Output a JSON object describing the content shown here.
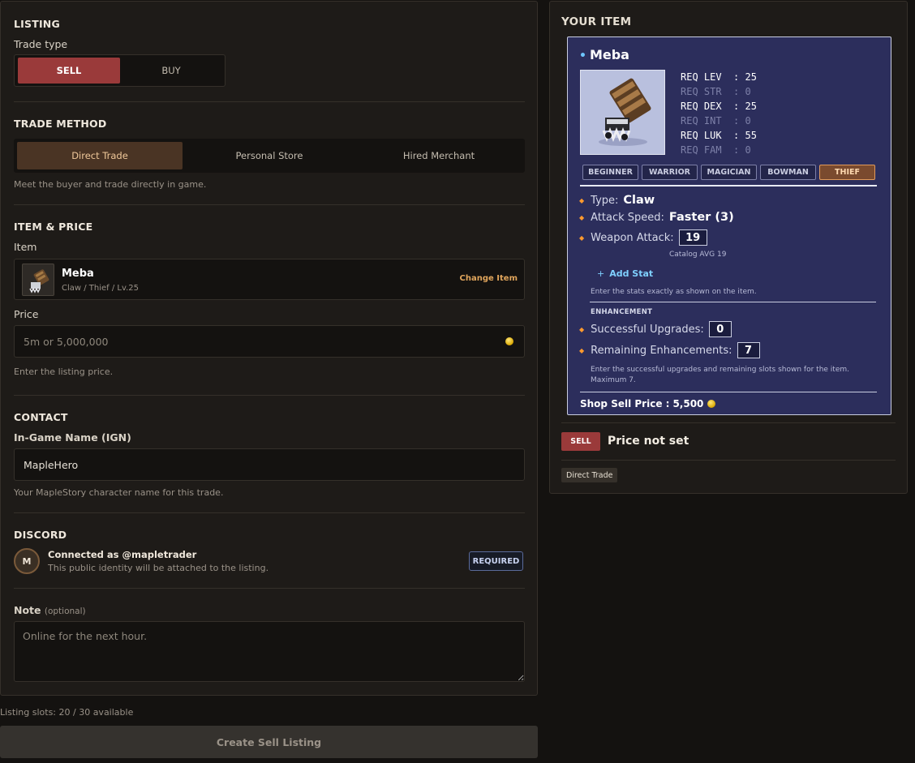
{
  "listing": {
    "section_title": "LISTING",
    "trade_type_label": "Trade type",
    "trade_types": {
      "sell": "SELL",
      "buy": "BUY"
    },
    "selected_trade_type": "SELL"
  },
  "trade_method": {
    "section_title": "TRADE METHOD",
    "options": [
      "Direct Trade",
      "Personal Store",
      "Hired Merchant"
    ],
    "selected": "Direct Trade",
    "hint": "Meet the buyer and trade directly in game."
  },
  "item_price": {
    "section_title": "ITEM & PRICE",
    "item_label": "Item",
    "item": {
      "name": "Meba",
      "subtitle": "Claw / Thief / Lv.25",
      "change_label": "Change Item"
    },
    "price_label": "Price",
    "price_value": "",
    "price_placeholder": "5m or 5,000,000",
    "price_hint": "Enter the listing price."
  },
  "contact": {
    "section_title": "CONTACT",
    "ign_label": "In-Game Name (IGN)",
    "ign_value": "MapleHero",
    "ign_hint": "Your MapleStory character name for this trade."
  },
  "discord": {
    "section_title": "DISCORD",
    "avatar_letter": "M",
    "connected_text": "Connected as @mapletrader",
    "identity_hint": "This public identity will be attached to the listing.",
    "required_badge": "REQUIRED"
  },
  "note": {
    "label": "Note",
    "optional": "(optional)",
    "value": "",
    "placeholder": "Online for the next hour."
  },
  "footer": {
    "slots_text": "Listing slots: 20 / 30 available",
    "create_button": "Create Sell Listing"
  },
  "preview": {
    "title": "YOUR ITEM",
    "item_name": "Meba",
    "requirements": [
      {
        "text": "REQ LEV  : 25",
        "met": true
      },
      {
        "text": "REQ STR  : 0",
        "met": false
      },
      {
        "text": "REQ DEX  : 25",
        "met": true
      },
      {
        "text": "REQ INT  : 0",
        "met": false
      },
      {
        "text": "REQ LUK  : 55",
        "met": true
      },
      {
        "text": "REQ FAM  : 0",
        "met": false
      }
    ],
    "jobs": [
      "BEGINNER",
      "WARRIOR",
      "MAGICIAN",
      "BOWMAN",
      "THIEF"
    ],
    "active_job": "THIEF",
    "type_label": "Type:",
    "type_value": "Claw",
    "speed_label": "Attack Speed:",
    "speed_value": "Faster (3)",
    "weapon_attack_label": "Weapon Attack:",
    "weapon_attack_value": "19",
    "catalog_avg": "Catalog AVG 19",
    "add_stat": "Add Stat",
    "stats_hint": "Enter the stats exactly as shown on the item.",
    "enhancement_title": "ENHANCEMENT",
    "upgrades_label": "Successful Upgrades:",
    "upgrades_value": "0",
    "remaining_label": "Remaining Enhancements:",
    "remaining_value": "7",
    "enhancement_hint_1": "Enter the successful upgrades and remaining slots shown for the item.",
    "enhancement_hint_2": "Maximum 7.",
    "shop_sell_label": "Shop Sell Price :",
    "shop_sell_value": "5,500",
    "badge": "SELL",
    "price_status": "Price not set",
    "method_tag": "Direct Trade"
  },
  "colors": {
    "accent_sell": "#9a3a3a",
    "accent_method": "#4a3424",
    "tooltip_bg": "#2c2e5c",
    "link_orange": "#e0a55c",
    "link_blue": "#7fd0ff"
  }
}
